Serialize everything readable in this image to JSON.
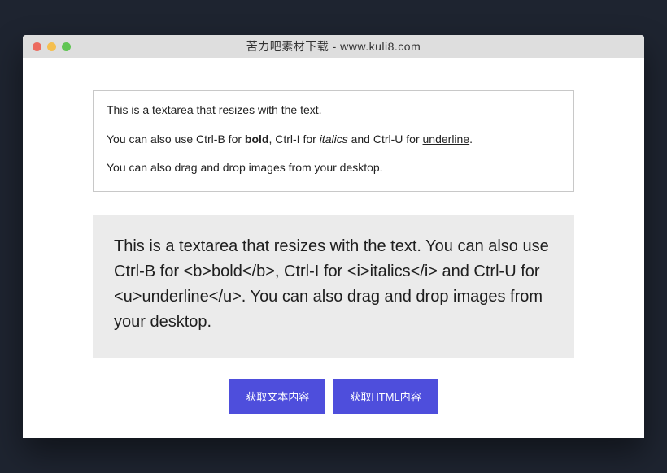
{
  "window": {
    "title": "苦力吧素材下载 - www.kuli8.com"
  },
  "editor": {
    "line1": "This is a textarea that resizes with the text.",
    "line2_pre": "You can also use Ctrl-B for ",
    "line2_bold": "bold",
    "line2_mid1": ", Ctrl-I for ",
    "line2_italic": "italics",
    "line2_mid2": " and Ctrl-U for ",
    "line2_underline": "underline",
    "line2_post": ".",
    "line3": "You can also drag and drop images from your desktop."
  },
  "preview": {
    "text": "This is a textarea that resizes with the text. You can also use Ctrl-B for <b>bold</b>, Ctrl-I for <i>italics</i> and Ctrl-U for <u>underline</u>. You can also drag and drop images from your desktop."
  },
  "buttons": {
    "get_text": "获取文本内容",
    "get_html": "获取HTML内容"
  },
  "colors": {
    "accent": "#4e4edc"
  }
}
